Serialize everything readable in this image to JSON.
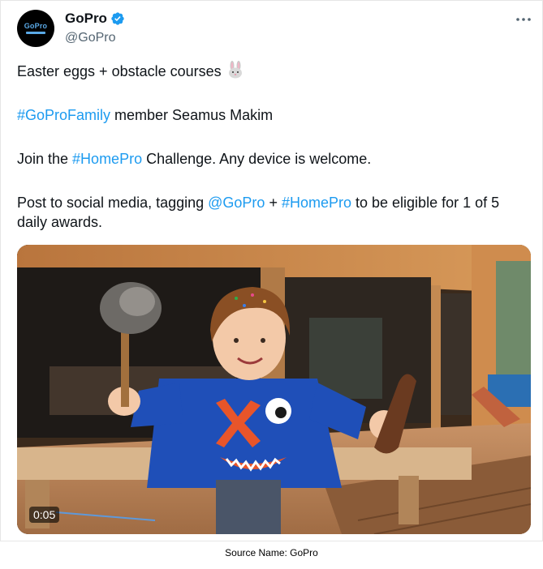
{
  "author": {
    "name": "GoPro",
    "handle": "@GoPro",
    "avatar_text": "GoPro",
    "verified": true
  },
  "icons": {
    "more": "more-horizontal-icon",
    "verified": "verified-badge-icon",
    "bunny": "rabbit-emoji-icon"
  },
  "tweet": {
    "line1": "Easter eggs + obstacle courses",
    "line2_hashtag": "#GoProFamily",
    "line2_rest": " member Seamus Makim",
    "line3_pre": "Join the ",
    "line3_hashtag": "#HomePro",
    "line3_post": " Challenge. Any device is welcome.",
    "line4_pre": "Post to social media, tagging ",
    "line4_mention": "@GoPro",
    "line4_mid": " + ",
    "line4_hashtag": "#HomePro",
    "line4_post": " to be eligible for 1 of 5 daily awards."
  },
  "video": {
    "duration": "0:05"
  },
  "colors": {
    "link": "#1d9bf0",
    "verified": "#1d9bf0",
    "handle": "#536471"
  },
  "caption": "Source Name: GoPro"
}
